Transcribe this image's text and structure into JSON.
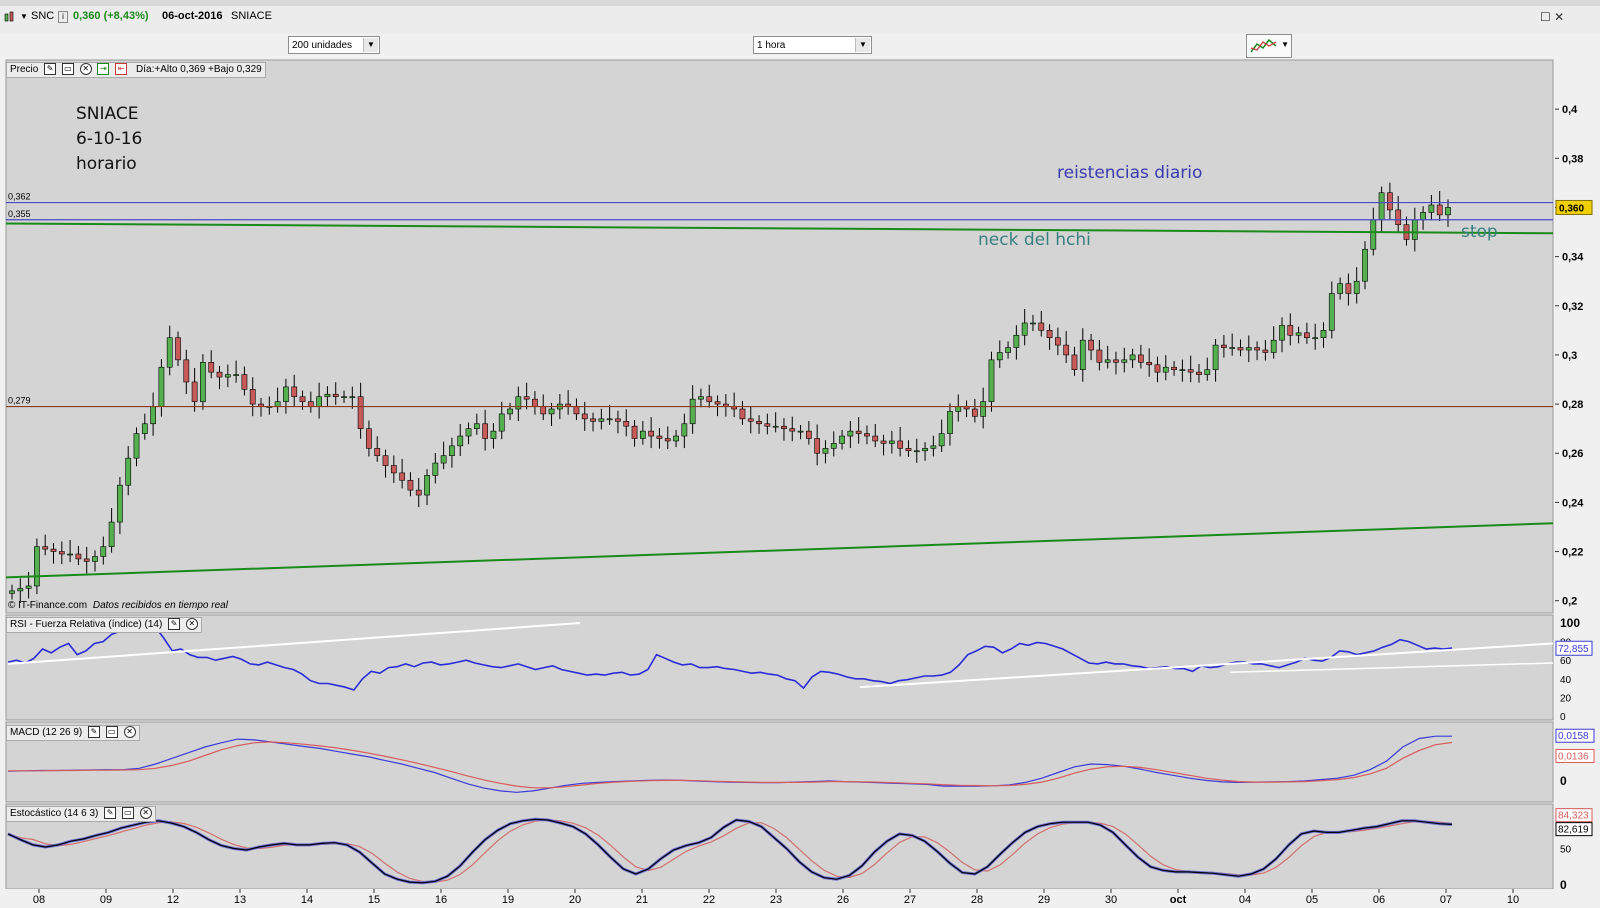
{
  "header": {
    "symbol": "SNC",
    "price_change": "0,360 (+8,43%)",
    "date": "06-oct-2016",
    "name": "SNIACE",
    "window_controls": "☐ ✕"
  },
  "toolbar": {
    "units_select": "200 unidades",
    "interval_select": "1 hora"
  },
  "price_panel": {
    "label": "Precio",
    "day_info": "Día:+Alto 0,369 +Bajo 0,329",
    "copyright": "© IT-Finance.com",
    "realtime": "Datos recibidos en tiempo real",
    "current_price_tag": "0,360",
    "level_labels": [
      "0,362",
      "0,355",
      "0,279"
    ]
  },
  "annotations": {
    "title_block": [
      "SNIACE",
      "6-10-16",
      "horario"
    ],
    "resistance": "reistencias diario",
    "neck": "neck del hchi",
    "stop": "stop"
  },
  "rsi_panel": {
    "label": "RSI - Fuerza Relativa (índice) (14)",
    "value_tag": "72,855",
    "ticks": [
      "100",
      "80",
      "60",
      "40",
      "20",
      "0"
    ]
  },
  "macd_panel": {
    "label": "MACD (12 26 9)",
    "value_tags": [
      "0,0158",
      "0,0136"
    ],
    "ticks": [
      "0"
    ]
  },
  "stoch_panel": {
    "label": "Estocástico (14 6 3)",
    "value_tags": [
      "84,323",
      "82,619"
    ],
    "ticks": [
      "50",
      "0"
    ]
  },
  "x_axis_labels": [
    "08",
    "09",
    "12",
    "13",
    "14",
    "15",
    "16",
    "19",
    "20",
    "21",
    "22",
    "23",
    "26",
    "27",
    "28",
    "29",
    "30",
    "oct",
    "04",
    "05",
    "06",
    "07",
    "10"
  ],
  "colors": {
    "chart_bg": "#d4d4d4",
    "up_candle": "#55b04f",
    "down_candle": "#c85a5a",
    "resistance_line": "#4a4ac8",
    "neck_line": "#1a8a1a",
    "support_level": "#8a3a1a",
    "rsi_line": "#2a2ad8",
    "macd_line": "#3a3ad8",
    "signal_line": "#d85a5a",
    "annotation_blue": "#3a3ab0",
    "annotation_teal": "#3a8080"
  },
  "chart_data": [
    {
      "type": "candlestick",
      "title": "SNIACE",
      "ylim": [
        0.195,
        0.42
      ],
      "y_ticks": [
        "0,4",
        "0,38",
        "0,36",
        "0,34",
        "0,32",
        "0,3",
        "0,28",
        "0,26",
        "0,24",
        "0,22",
        "0,2"
      ],
      "y_tick_values": [
        0.4,
        0.38,
        0.36,
        0.34,
        0.32,
        0.3,
        0.28,
        0.26,
        0.24,
        0.22,
        0.2
      ],
      "close": [
        0.204,
        0.205,
        0.206,
        0.222,
        0.221,
        0.22,
        0.219,
        0.219,
        0.217,
        0.216,
        0.218,
        0.222,
        0.232,
        0.247,
        0.258,
        0.268,
        0.272,
        0.279,
        0.295,
        0.307,
        0.298,
        0.289,
        0.281,
        0.297,
        0.293,
        0.291,
        0.292,
        0.292,
        0.286,
        0.28,
        0.279,
        0.279,
        0.281,
        0.287,
        0.283,
        0.281,
        0.279,
        0.283,
        0.284,
        0.283,
        0.283,
        0.283,
        0.27,
        0.262,
        0.259,
        0.255,
        0.252,
        0.249,
        0.245,
        0.243,
        0.251,
        0.256,
        0.259,
        0.263,
        0.267,
        0.27,
        0.272,
        0.266,
        0.269,
        0.276,
        0.278,
        0.283,
        0.282,
        0.279,
        0.276,
        0.278,
        0.28,
        0.279,
        0.276,
        0.274,
        0.273,
        0.274,
        0.274,
        0.273,
        0.271,
        0.266,
        0.269,
        0.267,
        0.266,
        0.265,
        0.267,
        0.272,
        0.282,
        0.283,
        0.281,
        0.28,
        0.279,
        0.278,
        0.274,
        0.273,
        0.272,
        0.271,
        0.271,
        0.27,
        0.269,
        0.269,
        0.266,
        0.26,
        0.262,
        0.264,
        0.267,
        0.269,
        0.268,
        0.267,
        0.265,
        0.264,
        0.265,
        0.262,
        0.261,
        0.261,
        0.262,
        0.263,
        0.268,
        0.277,
        0.279,
        0.278,
        0.275,
        0.281,
        0.298,
        0.301,
        0.303,
        0.308,
        0.313,
        0.313,
        0.31,
        0.307,
        0.304,
        0.3,
        0.294,
        0.306,
        0.302,
        0.297,
        0.298,
        0.297,
        0.298,
        0.3,
        0.297,
        0.296,
        0.293,
        0.295,
        0.294,
        0.294,
        0.293,
        0.292,
        0.294,
        0.304,
        0.303,
        0.303,
        0.302,
        0.303,
        0.302,
        0.301,
        0.306,
        0.312,
        0.308,
        0.309,
        0.307,
        0.307,
        0.31,
        0.325,
        0.329,
        0.325,
        0.33,
        0.343,
        0.355,
        0.366,
        0.359,
        0.353,
        0.347,
        0.355,
        0.358,
        0.361,
        0.357,
        0.36
      ]
    },
    {
      "type": "line",
      "title": "RSI - Fuerza Relativa (índice) (14)",
      "ylim": [
        0,
        100
      ],
      "values": [
        58,
        60,
        57,
        62,
        72,
        68,
        74,
        78,
        66,
        70,
        78,
        80,
        88,
        91,
        95,
        100,
        100,
        96,
        84,
        70,
        72,
        66,
        63,
        63,
        60,
        62,
        64,
        61,
        56,
        55,
        58,
        55,
        52,
        50,
        45,
        38,
        35,
        35,
        33,
        31,
        28,
        40,
        48,
        46,
        52,
        53,
        56,
        53,
        57,
        58,
        55,
        56,
        58,
        60,
        57,
        55,
        53,
        52,
        54,
        56,
        53,
        50,
        52,
        54,
        50,
        48,
        46,
        44,
        45,
        44,
        46,
        47,
        44,
        45,
        50,
        66,
        62,
        58,
        55,
        56,
        52,
        52,
        53,
        51,
        50,
        48,
        46,
        47,
        45,
        44,
        40,
        38,
        30,
        42,
        48,
        47,
        45,
        42,
        40,
        40,
        38,
        37,
        35,
        38,
        39,
        41,
        43,
        43,
        44,
        47,
        55,
        66,
        70,
        75,
        74,
        68,
        72,
        78,
        76,
        79,
        78,
        75,
        72,
        67,
        62,
        57,
        56,
        58,
        56,
        56,
        54,
        53,
        51,
        52,
        53,
        51,
        51,
        48,
        54,
        52,
        53,
        56,
        58,
        58,
        56,
        56,
        54,
        52,
        55,
        58,
        62,
        60,
        59,
        63,
        70,
        69,
        66,
        68,
        70,
        74,
        77,
        82,
        80,
        76,
        72,
        73,
        72,
        73
      ]
    },
    {
      "type": "line",
      "title": "MACD (12 26 9)",
      "series": [
        {
          "values": [
            0.0035,
            0.0036,
            0.0037,
            0.0037,
            0.0038,
            0.0039,
            0.004,
            0.004,
            0.0045,
            0.006,
            0.008,
            0.01,
            0.012,
            0.0135,
            0.0148,
            0.0145,
            0.0138,
            0.013,
            0.0122,
            0.0115,
            0.0105,
            0.0095,
            0.0085,
            0.0072,
            0.006,
            0.0045,
            0.003,
            0.001,
            -0.001,
            -0.0025,
            -0.0035,
            -0.004,
            -0.0035,
            -0.0025,
            -0.0015,
            -0.0008,
            -0.0005,
            -0.0002,
            0.0,
            0.0002,
            0.0003,
            0.0002,
            0.0,
            -0.0002,
            -0.0004,
            -0.0005,
            -0.0006,
            -0.0006,
            -0.0004,
            -0.0002,
            0.0,
            -0.0002,
            -0.0004,
            -0.0006,
            -0.0008,
            -0.001,
            -0.0012,
            -0.0018,
            -0.0018,
            -0.0018,
            -0.0017,
            -0.0014,
            -0.0005,
            0.001,
            0.003,
            0.005,
            0.006,
            0.0058,
            0.0052,
            0.0042,
            0.003,
            0.002,
            0.001,
            0.0002,
            -0.0003,
            -0.0005,
            -0.0004,
            -0.0003,
            -0.0002,
            0.0,
            0.0005,
            0.001,
            0.002,
            0.004,
            0.007,
            0.012,
            0.015,
            0.0158,
            0.0158
          ]
        },
        {
          "values": [
            0.0036,
            0.0036,
            0.0036,
            0.0037,
            0.0037,
            0.0038,
            0.0038,
            0.0039,
            0.004,
            0.0045,
            0.0055,
            0.007,
            0.009,
            0.011,
            0.0125,
            0.0135,
            0.0138,
            0.0135,
            0.013,
            0.0124,
            0.0117,
            0.0108,
            0.0098,
            0.0087,
            0.0075,
            0.0062,
            0.0048,
            0.0034,
            0.0018,
            0.0004,
            -0.0008,
            -0.0018,
            -0.0024,
            -0.0024,
            -0.002,
            -0.0014,
            -0.0008,
            -0.0004,
            -0.0001,
            0.0001,
            0.0002,
            0.0002,
            0.0001,
            -0.0001,
            -0.0002,
            -0.0004,
            -0.0005,
            -0.0005,
            -0.0005,
            -0.0004,
            -0.0002,
            -0.0002,
            -0.0003,
            -0.0004,
            -0.0006,
            -0.0008,
            -0.001,
            -0.0013,
            -0.0015,
            -0.0016,
            -0.0017,
            -0.0016,
            -0.0012,
            -0.0004,
            0.001,
            0.0028,
            0.0042,
            0.005,
            0.0052,
            0.0048,
            0.004,
            0.003,
            0.002,
            0.001,
            0.0003,
            -0.0002,
            -0.0004,
            -0.0004,
            -0.0003,
            -0.0002,
            0.0001,
            0.0005,
            0.0012,
            0.0025,
            0.0045,
            0.008,
            0.0108,
            0.0128,
            0.0136
          ]
        }
      ]
    },
    {
      "type": "line",
      "title": "Estocástico (14 6 3)",
      "ylim": [
        0,
        100
      ],
      "values": [
        70,
        62,
        55,
        52,
        55,
        60,
        63,
        68,
        72,
        78,
        82,
        86,
        88,
        85,
        80,
        72,
        62,
        54,
        50,
        48,
        52,
        55,
        57,
        55,
        55,
        57,
        58,
        55,
        45,
        30,
        15,
        8,
        4,
        3,
        5,
        12,
        26,
        45,
        62,
        75,
        84,
        88,
        90,
        89,
        85,
        80,
        70,
        55,
        38,
        22,
        15,
        22,
        36,
        48,
        54,
        58,
        65,
        79,
        89,
        87,
        80,
        65,
        50,
        32,
        18,
        10,
        8,
        13,
        26,
        45,
        60,
        70,
        68,
        60,
        46,
        30,
        17,
        15,
        25,
        42,
        58,
        72,
        80,
        84,
        86,
        86,
        86,
        82,
        72,
        55,
        38,
        25,
        20,
        18,
        18,
        17,
        16,
        14,
        12,
        15,
        22,
        36,
        55,
        70,
        74,
        72,
        72,
        75,
        78,
        80,
        84,
        88,
        88,
        86,
        84,
        83
      ]
    }
  ]
}
